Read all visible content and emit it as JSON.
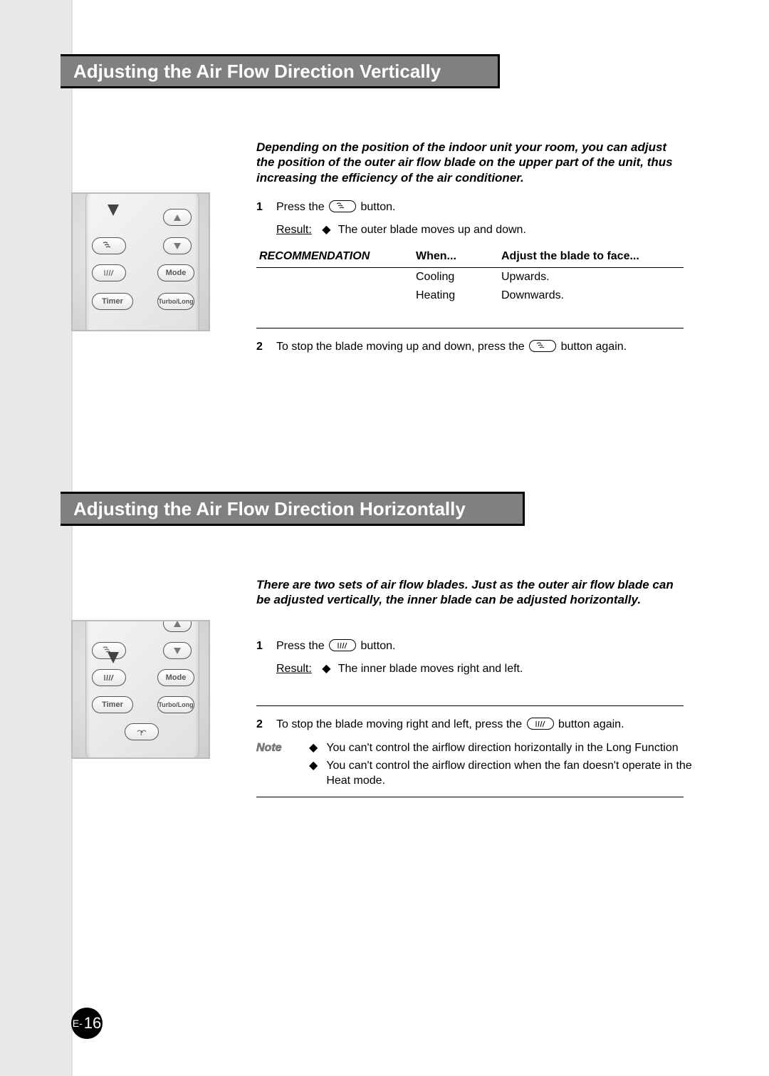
{
  "section1": {
    "title": "Adjusting the Air Flow Direction Vertically",
    "intro": "Depending on the position of the indoor unit your room, you can adjust the position of the outer air flow blade on the upper part of the unit, thus increasing the efficiency of the air conditioner.",
    "step1": {
      "num": "1",
      "pre": "Press the",
      "post": "button.",
      "result_label": "Result:",
      "result_text": "The outer blade moves up and down."
    },
    "rec": {
      "col1": "RECOMMENDATION",
      "col2": "When...",
      "col3": "Adjust the blade to face...",
      "rows": [
        {
          "when": "Cooling",
          "face": "Upwards."
        },
        {
          "when": "Heating",
          "face": "Downwards."
        }
      ]
    },
    "step2": {
      "num": "2",
      "pre": "To stop the blade moving up and down, press the",
      "post": "button again."
    }
  },
  "section2": {
    "title": "Adjusting the Air Flow Direction Horizontally",
    "intro": "There are two sets of air flow blades. Just as the outer air flow blade can be adjusted vertically, the inner blade can be adjusted horizontally.",
    "step1": {
      "num": "1",
      "pre": "Press the",
      "post": "button.",
      "result_label": "Result:",
      "result_text": "The inner blade moves right and left."
    },
    "step2": {
      "num": "2",
      "pre": "To stop the blade moving right and left, press the",
      "post": "button again."
    },
    "note": {
      "label": "Note",
      "items": [
        "You can't control the airflow direction horizontally in the Long Function",
        "You can't control the airflow direction when the fan doesn't operate in the Heat mode."
      ]
    }
  },
  "remote": {
    "mode": "Mode",
    "timer": "Timer",
    "turbo": "Turbo/Long"
  },
  "page": {
    "prefix": "E-",
    "num": "16"
  },
  "glyphs": {
    "diamond": "◆"
  }
}
